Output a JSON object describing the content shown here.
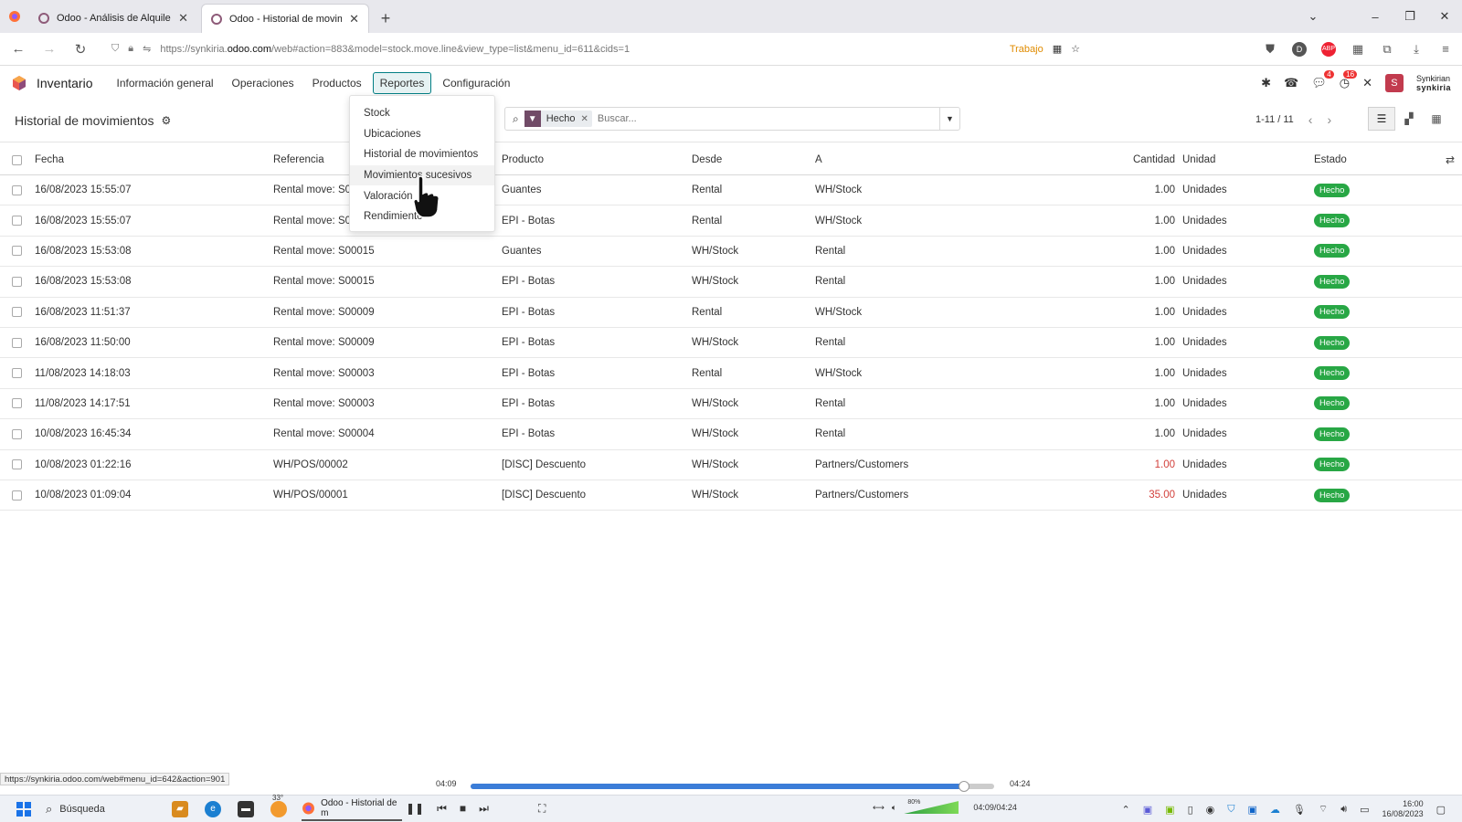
{
  "browser": {
    "tabs": [
      {
        "title": "Odoo - Análisis de Alquiler",
        "active": false
      },
      {
        "title": "Odoo - Historial de movimient",
        "active": true
      }
    ],
    "url_prefix": "https://synkiria.",
    "url_domain": "odoo.com",
    "url_suffix": "/web#action=883&model=stock.move.line&view_type=list&menu_id=611&cids=1",
    "profile_label": "Trabajo"
  },
  "app": {
    "name": "Inventario",
    "menu": [
      {
        "label": "Información general"
      },
      {
        "label": "Operaciones"
      },
      {
        "label": "Productos"
      },
      {
        "label": "Reportes"
      },
      {
        "label": "Configuración"
      }
    ],
    "user": {
      "initial": "S",
      "line1": "Synkirian",
      "line2": "synkiria"
    },
    "badges": {
      "messages": "4",
      "activities": "16"
    }
  },
  "reportes_menu": [
    "Stock",
    "Ubicaciones",
    "Historial de movimientos",
    "Movimientos sucesivos",
    "Valoración",
    "Rendimiento"
  ],
  "control": {
    "title": "Historial de movimientos",
    "facet": "Hecho",
    "search_placeholder": "Buscar...",
    "pager": "1-11 / 11"
  },
  "table": {
    "headers": {
      "fecha": "Fecha",
      "referencia": "Referencia",
      "producto": "Producto",
      "desde": "Desde",
      "a": "A",
      "cantidad": "Cantidad",
      "unidad": "Unidad",
      "estado": "Estado"
    },
    "rows": [
      {
        "fecha": "16/08/2023 15:55:07",
        "referencia": "Rental move: S0",
        "producto": "Guantes",
        "desde": "Rental",
        "a": "WH/Stock",
        "cantidad": "1.00",
        "unidad": "Unidades",
        "estado": "Hecho",
        "neg": false
      },
      {
        "fecha": "16/08/2023 15:55:07",
        "referencia": "Rental move: S0",
        "producto": "EPI - Botas",
        "desde": "Rental",
        "a": "WH/Stock",
        "cantidad": "1.00",
        "unidad": "Unidades",
        "estado": "Hecho",
        "neg": false
      },
      {
        "fecha": "16/08/2023 15:53:08",
        "referencia": "Rental move: S00015",
        "producto": "Guantes",
        "desde": "WH/Stock",
        "a": "Rental",
        "cantidad": "1.00",
        "unidad": "Unidades",
        "estado": "Hecho",
        "neg": false
      },
      {
        "fecha": "16/08/2023 15:53:08",
        "referencia": "Rental move: S00015",
        "producto": "EPI - Botas",
        "desde": "WH/Stock",
        "a": "Rental",
        "cantidad": "1.00",
        "unidad": "Unidades",
        "estado": "Hecho",
        "neg": false
      },
      {
        "fecha": "16/08/2023 11:51:37",
        "referencia": "Rental move: S00009",
        "producto": "EPI - Botas",
        "desde": "Rental",
        "a": "WH/Stock",
        "cantidad": "1.00",
        "unidad": "Unidades",
        "estado": "Hecho",
        "neg": false
      },
      {
        "fecha": "16/08/2023 11:50:00",
        "referencia": "Rental move: S00009",
        "producto": "EPI - Botas",
        "desde": "WH/Stock",
        "a": "Rental",
        "cantidad": "1.00",
        "unidad": "Unidades",
        "estado": "Hecho",
        "neg": false
      },
      {
        "fecha": "11/08/2023 14:18:03",
        "referencia": "Rental move: S00003",
        "producto": "EPI - Botas",
        "desde": "Rental",
        "a": "WH/Stock",
        "cantidad": "1.00",
        "unidad": "Unidades",
        "estado": "Hecho",
        "neg": false
      },
      {
        "fecha": "11/08/2023 14:17:51",
        "referencia": "Rental move: S00003",
        "producto": "EPI - Botas",
        "desde": "WH/Stock",
        "a": "Rental",
        "cantidad": "1.00",
        "unidad": "Unidades",
        "estado": "Hecho",
        "neg": false
      },
      {
        "fecha": "10/08/2023 16:45:34",
        "referencia": "Rental move: S00004",
        "producto": "EPI - Botas",
        "desde": "WH/Stock",
        "a": "Rental",
        "cantidad": "1.00",
        "unidad": "Unidades",
        "estado": "Hecho",
        "neg": false
      },
      {
        "fecha": "10/08/2023 01:22:16",
        "referencia": "WH/POS/00002",
        "producto": "[DISC] Descuento",
        "desde": "WH/Stock",
        "a": "Partners/Customers",
        "cantidad": "1.00",
        "unidad": "Unidades",
        "estado": "Hecho",
        "neg": true
      },
      {
        "fecha": "10/08/2023 01:09:04",
        "referencia": "WH/POS/00001",
        "producto": "[DISC] Descuento",
        "desde": "WH/Stock",
        "a": "Partners/Customers",
        "cantidad": "35.00",
        "unidad": "Unidades",
        "estado": "Hecho",
        "neg": true
      }
    ]
  },
  "status_link": "https://synkiria.odoo.com/web#menu_id=642&action=901",
  "video": {
    "elapsed": "04:09",
    "total": "04:24",
    "progress": 0.943,
    "counter": "04:09/04:24",
    "volume": "80%"
  },
  "taskbar": {
    "search": "Búsqueda",
    "temp": "33°",
    "app_title": "Odoo - Historial de m",
    "time": "16:00",
    "date": "16/08/2023"
  },
  "colors": {
    "accent": "#017e84",
    "brand": "#714b67",
    "status": "#28a745",
    "negative": "#d23f3a"
  }
}
